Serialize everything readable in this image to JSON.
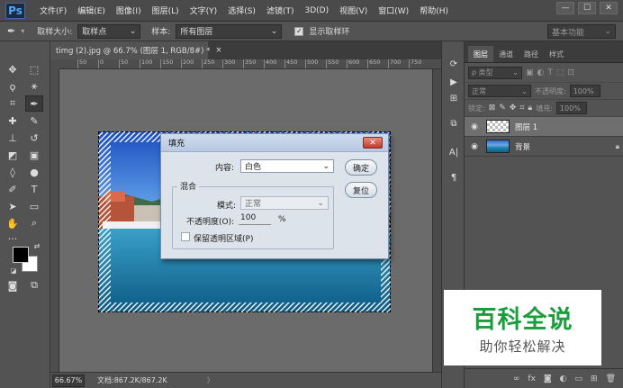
{
  "app": {
    "logo": "Ps"
  },
  "menu": [
    "文件(F)",
    "编辑(E)",
    "图像(I)",
    "图层(L)",
    "文字(Y)",
    "选择(S)",
    "滤镜(T)",
    "3D(D)",
    "视图(V)",
    "窗口(W)",
    "帮助(H)"
  ],
  "window_controls": {
    "minimize": "—",
    "restore": "☐",
    "close": "✕"
  },
  "options": {
    "sample_size_label": "取样大小:",
    "sample_size_value": "取样点",
    "sample_label": "样本:",
    "sample_value": "所有图层",
    "show_ring_label": "显示取样环",
    "show_ring_checked": true,
    "workspace": "基本功能"
  },
  "document": {
    "tab_title": "timg (2).jpg @ 66.7% (图层 1, RGB/8#) *",
    "tab_close": "×",
    "ruler_ticks": [
      "50",
      "0",
      "50",
      "100",
      "150",
      "200",
      "250",
      "300",
      "350",
      "400",
      "450",
      "500",
      "550",
      "600",
      "650",
      "700",
      "750"
    ]
  },
  "status": {
    "zoom": "66.67%",
    "doc": "文档:867.2K/867.2K",
    "arrow": "〉"
  },
  "panels": {
    "tabs": [
      "图层",
      "通道",
      "路径",
      "样式"
    ],
    "kind_label": "ρ 类型",
    "blend_mode": "正常",
    "opacity_label": "不透明度:",
    "opacity_value": "100%",
    "lock_label": "锁定:",
    "fill_label": "填充:",
    "fill_value": "100%",
    "layers": [
      {
        "name": "图层 1",
        "selected": true,
        "thumb": "transparent"
      },
      {
        "name": "背景",
        "selected": false,
        "thumb": "image",
        "locked": true
      }
    ]
  },
  "fill_dialog": {
    "title": "填充",
    "close": "✕",
    "content_label": "内容:",
    "content_value": "白色",
    "ok_button": "确定",
    "reset_button": "复位",
    "blend_group": "混合",
    "mode_label": "模式:",
    "mode_value": "正常",
    "opacity_label": "不透明度(O):",
    "opacity_value": "100",
    "opacity_unit": "%",
    "preserve_label": "保留透明区域(P)",
    "preserve_checked": false
  },
  "watermark": {
    "title": "百科全说",
    "subtitle": "助你轻松解决"
  },
  "colors": {
    "accent": "#4aa8ff",
    "watermark_green": "#1a9e3d",
    "panel_bg": "#535353",
    "canvas_bg": "#6b6b6b"
  }
}
